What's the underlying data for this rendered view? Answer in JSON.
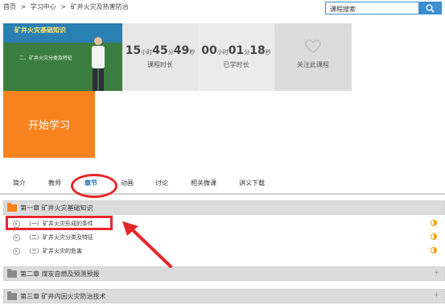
{
  "breadcrumb": {
    "home": "首页",
    "sep1": ">",
    "center": "学习中心",
    "sep2": ">",
    "course": "矿井火灾及热害防治"
  },
  "search": {
    "placeholder": "课程搜索"
  },
  "thumbnail": {
    "title": "矿井火灾基础知识",
    "subtitle": "二、矿井火灾分类及特征"
  },
  "stats": {
    "duration": {
      "h": "15",
      "h_unit": "小时",
      "m": "45",
      "m_unit": "分",
      "s": "49",
      "s_unit": "秒",
      "label": "课程时长"
    },
    "studied": {
      "h": "00",
      "h_unit": "小时",
      "m": "01",
      "m_unit": "分",
      "s": "18",
      "s_unit": "秒",
      "label": "已学时长"
    },
    "follow": {
      "label": "关注此课程"
    }
  },
  "start_button": "开始学习",
  "tabs": [
    {
      "label": "简介"
    },
    {
      "label": "教师"
    },
    {
      "label": "章节",
      "active": true
    },
    {
      "label": "动画"
    },
    {
      "label": "讨论"
    },
    {
      "label": "相关微课"
    },
    {
      "label": "讲义下载"
    }
  ],
  "chapters": [
    {
      "title": "第一章  矿井火灾基础知识",
      "folder_color": "#f7821e",
      "expanded": true,
      "items": [
        {
          "title": "（一）矿井火灾形成的条件",
          "progress": 0.5
        },
        {
          "title": "（二）矿井火灾分类及特征",
          "progress": 0.5
        },
        {
          "title": "（三）矿井火灾的危害",
          "progress": 0.5
        }
      ]
    },
    {
      "title": "第二章  煤炭自燃及预测预报",
      "folder_color": "#8a8a8a",
      "expanded": false,
      "toggle": "+"
    },
    {
      "title": "第三章  矿井内因火灾防治技术",
      "folder_color": "#8a8a8a",
      "expanded": false,
      "toggle": "+"
    }
  ],
  "colors": {
    "accent": "#3b8ed0",
    "start": "#f7821e",
    "annotation": "#e8262a",
    "active_tab": "#1a6fc0"
  }
}
